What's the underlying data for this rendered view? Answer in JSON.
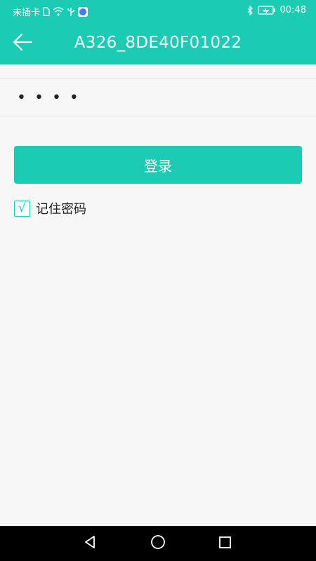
{
  "status_bar": {
    "carrier": "未插卡",
    "time": "00:48",
    "icons": [
      "sim-icon",
      "wifi-icon",
      "usb-icon",
      "app-notification-icon",
      "bluetooth-icon",
      "battery-icon"
    ]
  },
  "header": {
    "title": "A326_8DE40F01022",
    "back_icon": "back-arrow-icon"
  },
  "form": {
    "password_value": "••••",
    "login_label": "登录",
    "remember_label": "记住密码",
    "remember_checked_mark": "√",
    "remember_checked": true
  },
  "nav_bar": {
    "icons": [
      "back-triangle-icon",
      "home-circle-icon",
      "recents-square-icon"
    ]
  },
  "colors": {
    "accent": "#1ccbb4",
    "background": "#f7f7f7",
    "nav_background": "#000000"
  }
}
